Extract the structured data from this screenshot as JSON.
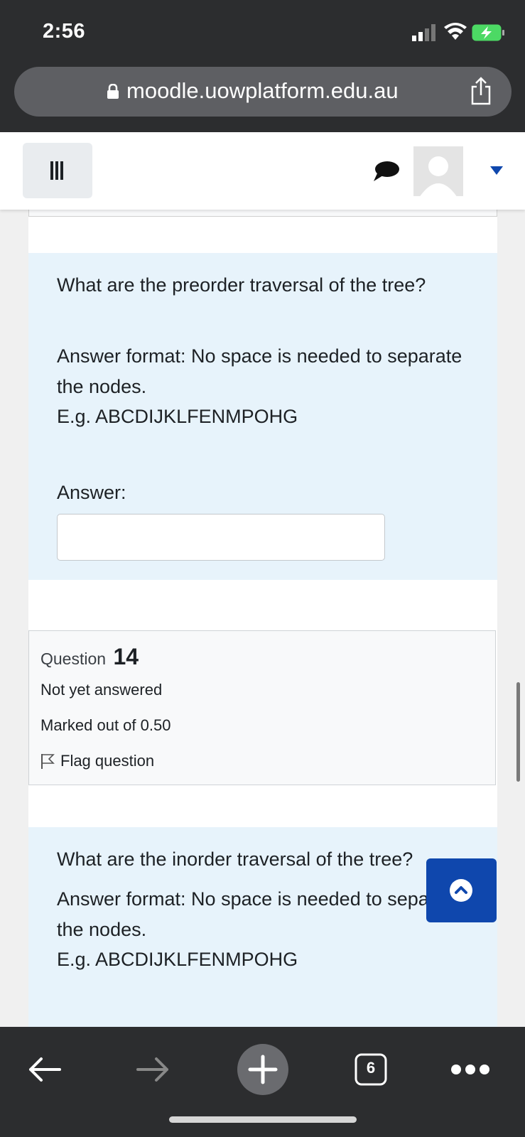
{
  "status": {
    "time": "2:56"
  },
  "browser": {
    "url": "moodle.uowplatform.edu.au",
    "tab_count": "6"
  },
  "questions": {
    "q13": {
      "prompt": "What are the preorder traversal of the tree?",
      "format": "Answer format: No space is needed to separate the nodes.",
      "example": "E.g. ABCDIJKLFENMPOHG",
      "answer_label": "Answer:",
      "answer_value": ""
    },
    "q14": {
      "question_word": "Question",
      "number": "14",
      "state": "Not yet answered",
      "grade": "Marked out of 0.50",
      "flag_label": "Flag question",
      "prompt": "What are the inorder traversal of the tree?",
      "format": "Answer format: No space is needed to separate the nodes.",
      "example": "E.g. ABCDIJKLFENMPOHG"
    }
  },
  "colors": {
    "accent": "#0f47ad",
    "question_bg": "#e7f3fb",
    "info_bg": "#f8f9fa"
  }
}
